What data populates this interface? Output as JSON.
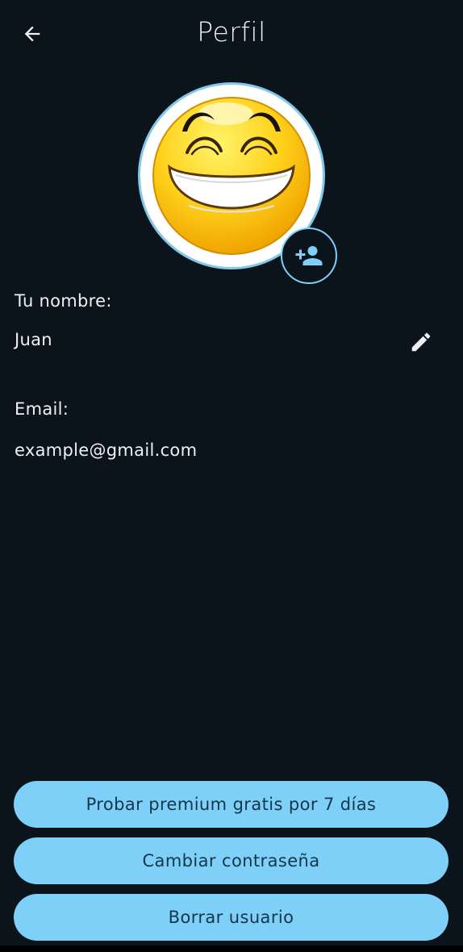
{
  "header": {
    "title": "Perfil",
    "back_icon": "arrow-left-icon"
  },
  "profile": {
    "avatar_icon": "grinning-emoji-avatar",
    "add_photo_icon": "person-add-icon",
    "name_label": "Tu nombre:",
    "name_value": "Juan",
    "edit_icon": "pencil-icon",
    "email_label": "Email:",
    "email_value": "example@gmail.com"
  },
  "actions": {
    "premium_label": "Probar premium gratis por 7 días",
    "change_password_label": "Cambiar contraseña",
    "delete_user_label": "Borrar usuario"
  },
  "colors": {
    "background": "#0b131b",
    "accent": "#7fd0f9",
    "button_text": "#13364a",
    "text": "#eef1f4"
  }
}
